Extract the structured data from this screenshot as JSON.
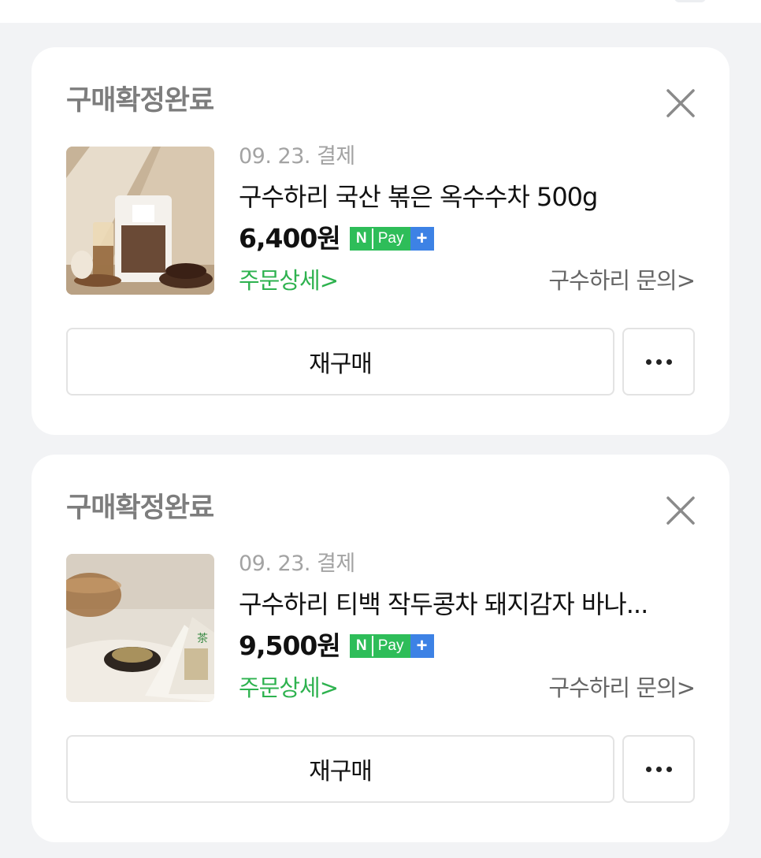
{
  "orders": [
    {
      "status": "구매확정완료",
      "date": "09. 23. 결제",
      "title": "구수하리 국산 볶은 옥수수차 500g",
      "price": "6,400원",
      "detail_link": "주문상세>",
      "inquiry_link": "구수하리 문의>",
      "rebuy_label": "재구매",
      "thumbnail": "roasted-corn-tea-bag-image"
    },
    {
      "status": "구매확정완료",
      "date": "09. 23. 결제",
      "title": "구수하리 티백 작두콩차 돼지감자 바나...",
      "price": "9,500원",
      "detail_link": "주문상세>",
      "inquiry_link": "구수하리 문의>",
      "rebuy_label": "재구매",
      "thumbnail": "sword-bean-teabag-image"
    }
  ],
  "npay_badge": {
    "n": "N",
    "pay": "Pay",
    "plus": "+"
  },
  "icons": {
    "close": "close-icon",
    "more": "more-dots-icon"
  },
  "colors": {
    "accent_green": "#2eb24f",
    "npay_green": "#2ebd59",
    "npay_blue": "#3d82e5",
    "status_gray": "#7d7d7d"
  }
}
